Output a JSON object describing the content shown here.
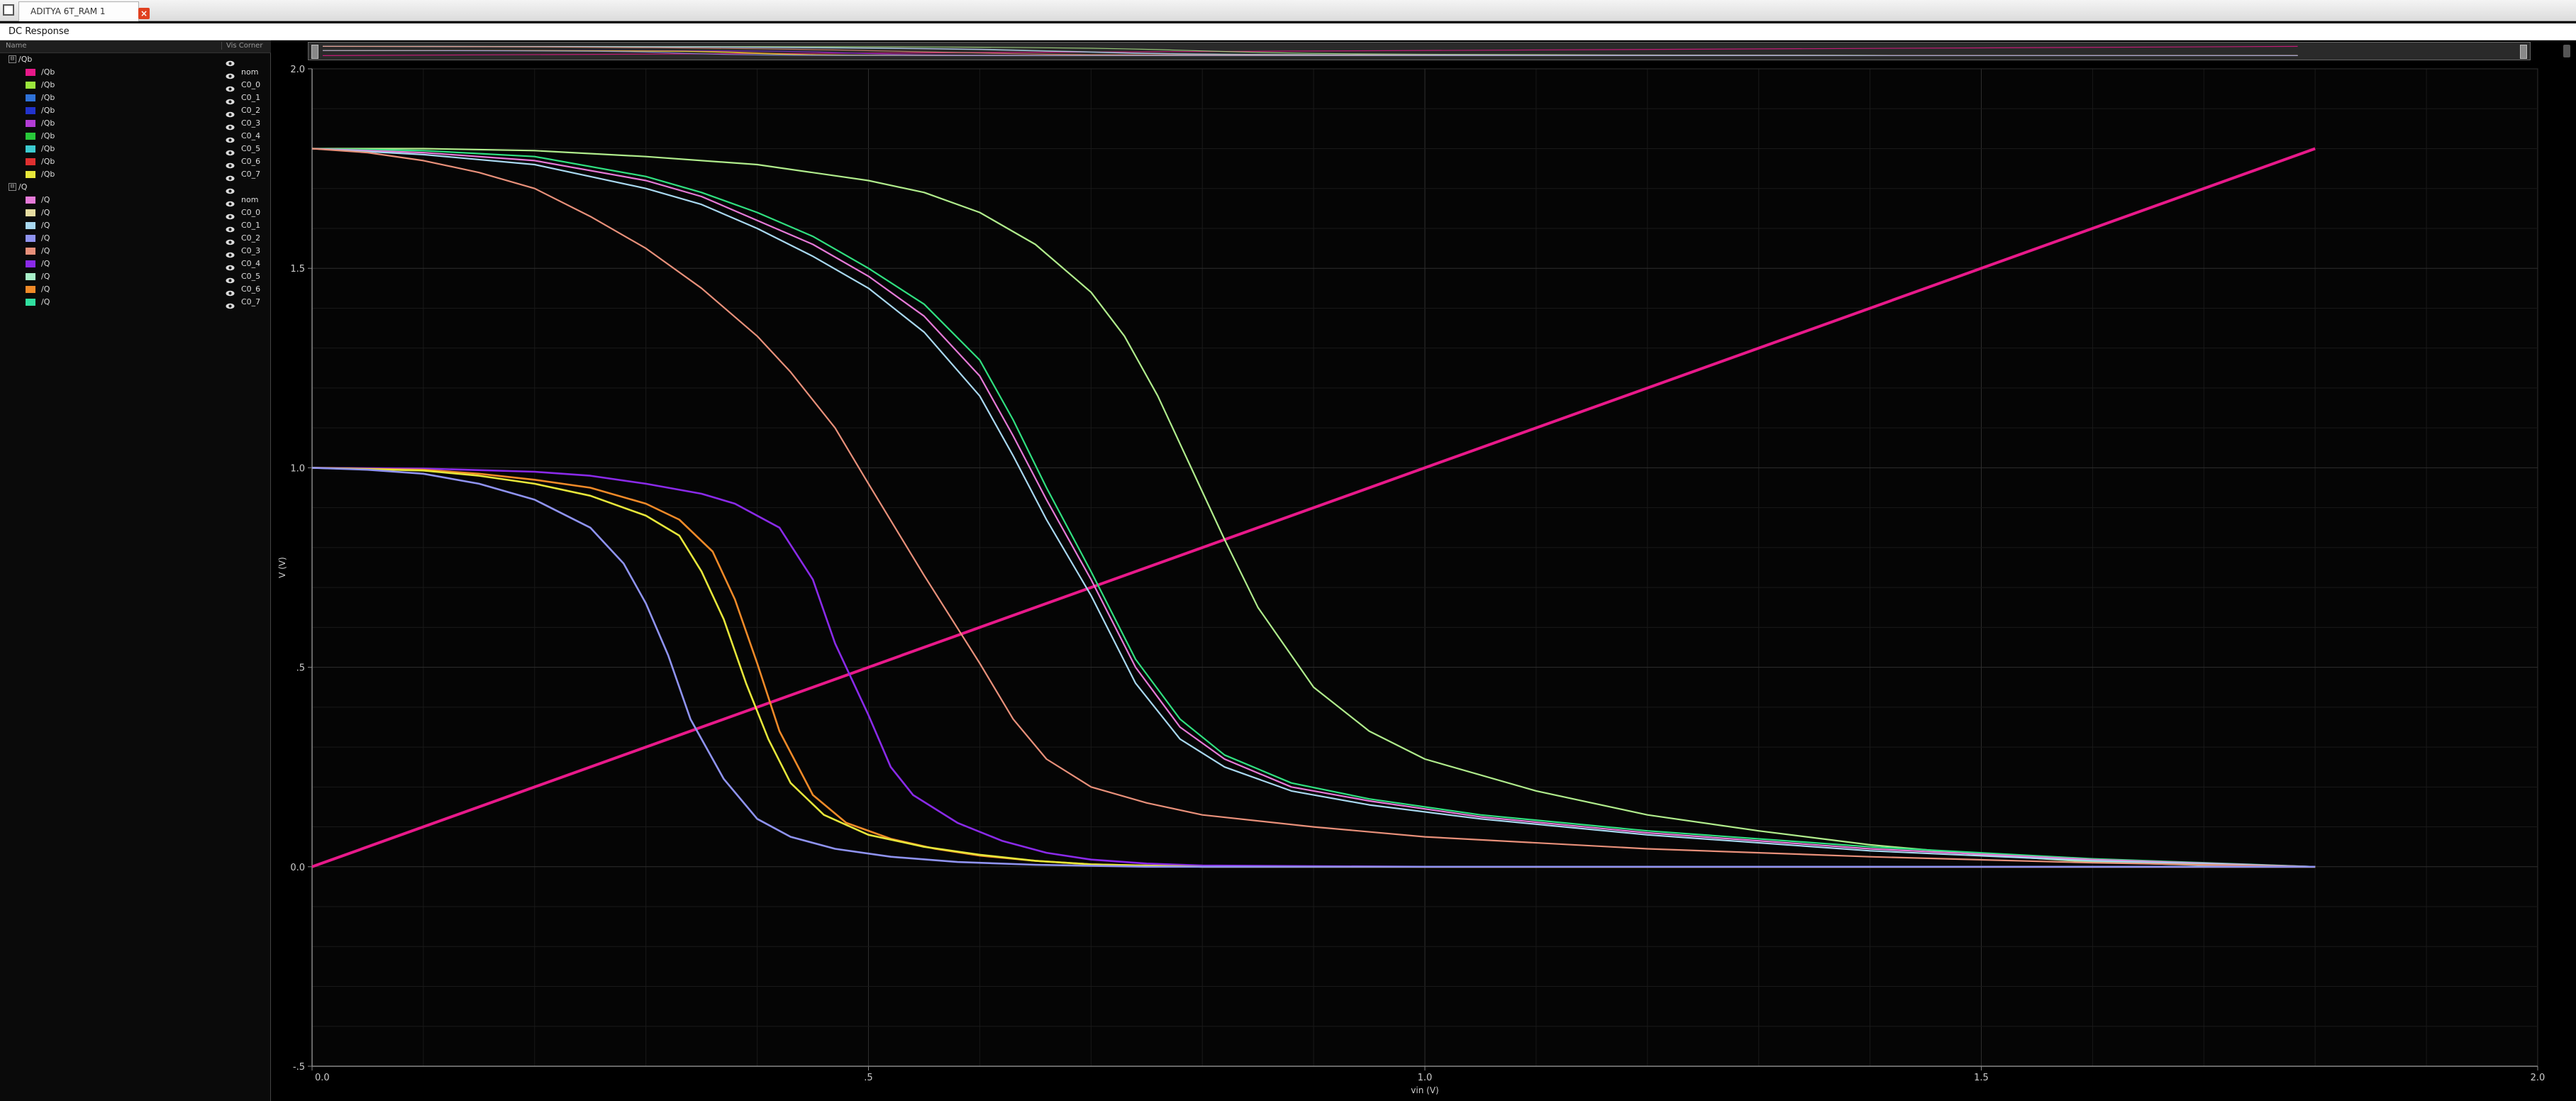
{
  "window": {
    "tab_title": "ADITYA 6T_RAM 1",
    "panel_title": "DC Response"
  },
  "browser": {
    "header_name": "Name",
    "header_corner": "Vis Corner",
    "groups": [
      {
        "name": "/Qb",
        "collapse_symbol": "⊟",
        "signals": [
          {
            "name": "/Qb",
            "corner": "nom",
            "color": "#e8198a"
          },
          {
            "name": "/Qb",
            "corner": "C0_0",
            "color": "#9be63c"
          },
          {
            "name": "/Qb",
            "corner": "C0_1",
            "color": "#2f72d8"
          },
          {
            "name": "/Qb",
            "corner": "C0_2",
            "color": "#2233cc"
          },
          {
            "name": "/Qb",
            "corner": "C0_3",
            "color": "#b33cd6"
          },
          {
            "name": "/Qb",
            "corner": "C0_4",
            "color": "#28c83a"
          },
          {
            "name": "/Qb",
            "corner": "C0_5",
            "color": "#3ccbd0"
          },
          {
            "name": "/Qb",
            "corner": "C0_6",
            "color": "#e03030"
          },
          {
            "name": "/Qb",
            "corner": "C0_7",
            "color": "#e6e63a"
          }
        ]
      },
      {
        "name": "/Q",
        "collapse_symbol": "⊟",
        "signals": [
          {
            "name": "/Q",
            "corner": "nom",
            "color": "#e67ad8"
          },
          {
            "name": "/Q",
            "corner": "C0_0",
            "color": "#e6dca0"
          },
          {
            "name": "/Q",
            "corner": "C0_1",
            "color": "#a8d8f0"
          },
          {
            "name": "/Q",
            "corner": "C0_2",
            "color": "#8f93f0"
          },
          {
            "name": "/Q",
            "corner": "C0_3",
            "color": "#e8907a"
          },
          {
            "name": "/Q",
            "corner": "C0_4",
            "color": "#8a2ae8"
          },
          {
            "name": "/Q",
            "corner": "C0_5",
            "color": "#a8f0c8"
          },
          {
            "name": "/Q",
            "corner": "C0_6",
            "color": "#f08a28"
          },
          {
            "name": "/Q",
            "corner": "C0_7",
            "color": "#30e0a0"
          }
        ]
      }
    ]
  },
  "chart_data": {
    "type": "line",
    "title": "",
    "xlabel": "vin (V)",
    "ylabel": "V (V)",
    "xlim": [
      0.0,
      2.0
    ],
    "ylim": [
      -0.5,
      2.0
    ],
    "x_ticks": [
      {
        "value": 0.0,
        "label": "0.0"
      },
      {
        "value": 0.5,
        "label": ".5"
      },
      {
        "value": 1.0,
        "label": "1.0"
      },
      {
        "value": 1.5,
        "label": "1.5"
      },
      {
        "value": 2.0,
        "label": "2.0"
      }
    ],
    "y_ticks": [
      {
        "value": -0.5,
        "label": "-.5"
      },
      {
        "value": 0.0,
        "label": "0.0"
      },
      {
        "value": 0.5,
        "label": ".5"
      },
      {
        "value": 1.0,
        "label": "1.0"
      },
      {
        "value": 1.5,
        "label": "1.5"
      },
      {
        "value": 2.0,
        "label": "2.0"
      }
    ],
    "grid": true,
    "series": [
      {
        "color": "#e8198a",
        "width": 4,
        "points": [
          [
            0.0,
            0.0
          ],
          [
            1.8,
            1.8
          ]
        ]
      },
      {
        "color": "#b0ec8c",
        "width": 2.2,
        "points": [
          [
            0.0,
            1.8
          ],
          [
            0.1,
            1.8
          ],
          [
            0.2,
            1.795
          ],
          [
            0.3,
            1.78
          ],
          [
            0.4,
            1.76
          ],
          [
            0.5,
            1.72
          ],
          [
            0.55,
            1.69
          ],
          [
            0.6,
            1.64
          ],
          [
            0.65,
            1.56
          ],
          [
            0.7,
            1.44
          ],
          [
            0.73,
            1.33
          ],
          [
            0.76,
            1.18
          ],
          [
            0.79,
            1.0
          ],
          [
            0.82,
            0.82
          ],
          [
            0.85,
            0.65
          ],
          [
            0.9,
            0.45
          ],
          [
            0.95,
            0.34
          ],
          [
            1.0,
            0.27
          ],
          [
            1.1,
            0.19
          ],
          [
            1.2,
            0.13
          ],
          [
            1.3,
            0.09
          ],
          [
            1.4,
            0.055
          ],
          [
            1.5,
            0.03
          ],
          [
            1.6,
            0.012
          ],
          [
            1.7,
            0.004
          ],
          [
            1.8,
            0.0
          ]
        ]
      },
      {
        "color": "#30e080",
        "width": 2.2,
        "points": [
          [
            0.0,
            1.8
          ],
          [
            0.1,
            1.795
          ],
          [
            0.2,
            1.78
          ],
          [
            0.3,
            1.73
          ],
          [
            0.35,
            1.69
          ],
          [
            0.4,
            1.64
          ],
          [
            0.45,
            1.58
          ],
          [
            0.5,
            1.5
          ],
          [
            0.55,
            1.41
          ],
          [
            0.6,
            1.27
          ],
          [
            0.63,
            1.12
          ],
          [
            0.66,
            0.95
          ],
          [
            0.7,
            0.74
          ],
          [
            0.74,
            0.52
          ],
          [
            0.78,
            0.37
          ],
          [
            0.82,
            0.28
          ],
          [
            0.88,
            0.21
          ],
          [
            0.95,
            0.17
          ],
          [
            1.05,
            0.13
          ],
          [
            1.2,
            0.09
          ],
          [
            1.4,
            0.05
          ],
          [
            1.6,
            0.02
          ],
          [
            1.8,
            0.0
          ]
        ]
      },
      {
        "color": "#e67ad8",
        "width": 2.2,
        "points": [
          [
            0.0,
            1.8
          ],
          [
            0.1,
            1.79
          ],
          [
            0.2,
            1.77
          ],
          [
            0.3,
            1.72
          ],
          [
            0.35,
            1.68
          ],
          [
            0.4,
            1.62
          ],
          [
            0.45,
            1.56
          ],
          [
            0.5,
            1.48
          ],
          [
            0.55,
            1.38
          ],
          [
            0.6,
            1.23
          ],
          [
            0.63,
            1.08
          ],
          [
            0.66,
            0.92
          ],
          [
            0.7,
            0.72
          ],
          [
            0.74,
            0.5
          ],
          [
            0.78,
            0.35
          ],
          [
            0.82,
            0.27
          ],
          [
            0.88,
            0.2
          ],
          [
            0.95,
            0.165
          ],
          [
            1.05,
            0.125
          ],
          [
            1.2,
            0.085
          ],
          [
            1.4,
            0.045
          ],
          [
            1.6,
            0.018
          ],
          [
            1.8,
            0.0
          ]
        ]
      },
      {
        "color": "#a8d8f0",
        "width": 2.2,
        "points": [
          [
            0.0,
            1.8
          ],
          [
            0.1,
            1.785
          ],
          [
            0.2,
            1.76
          ],
          [
            0.3,
            1.7
          ],
          [
            0.35,
            1.66
          ],
          [
            0.4,
            1.6
          ],
          [
            0.45,
            1.53
          ],
          [
            0.5,
            1.45
          ],
          [
            0.55,
            1.34
          ],
          [
            0.6,
            1.18
          ],
          [
            0.63,
            1.03
          ],
          [
            0.66,
            0.87
          ],
          [
            0.7,
            0.68
          ],
          [
            0.74,
            0.46
          ],
          [
            0.78,
            0.32
          ],
          [
            0.82,
            0.25
          ],
          [
            0.88,
            0.19
          ],
          [
            0.95,
            0.155
          ],
          [
            1.05,
            0.12
          ],
          [
            1.2,
            0.08
          ],
          [
            1.4,
            0.04
          ],
          [
            1.6,
            0.015
          ],
          [
            1.8,
            0.0
          ]
        ]
      },
      {
        "color": "#e8907a",
        "width": 2.2,
        "points": [
          [
            0.0,
            1.8
          ],
          [
            0.05,
            1.79
          ],
          [
            0.1,
            1.77
          ],
          [
            0.15,
            1.74
          ],
          [
            0.2,
            1.7
          ],
          [
            0.25,
            1.63
          ],
          [
            0.3,
            1.55
          ],
          [
            0.35,
            1.45
          ],
          [
            0.4,
            1.33
          ],
          [
            0.43,
            1.24
          ],
          [
            0.47,
            1.1
          ],
          [
            0.5,
            0.96
          ],
          [
            0.55,
            0.73
          ],
          [
            0.6,
            0.51
          ],
          [
            0.63,
            0.37
          ],
          [
            0.66,
            0.27
          ],
          [
            0.7,
            0.2
          ],
          [
            0.75,
            0.16
          ],
          [
            0.8,
            0.13
          ],
          [
            0.9,
            0.1
          ],
          [
            1.0,
            0.075
          ],
          [
            1.2,
            0.045
          ],
          [
            1.4,
            0.025
          ],
          [
            1.6,
            0.01
          ],
          [
            1.8,
            0.0
          ]
        ]
      },
      {
        "color": "#8a2ae8",
        "width": 2.6,
        "points": [
          [
            0.0,
            1.0
          ],
          [
            0.1,
            0.998
          ],
          [
            0.2,
            0.99
          ],
          [
            0.25,
            0.98
          ],
          [
            0.3,
            0.96
          ],
          [
            0.35,
            0.935
          ],
          [
            0.38,
            0.91
          ],
          [
            0.42,
            0.85
          ],
          [
            0.45,
            0.72
          ],
          [
            0.47,
            0.56
          ],
          [
            0.5,
            0.38
          ],
          [
            0.52,
            0.25
          ],
          [
            0.54,
            0.18
          ],
          [
            0.58,
            0.11
          ],
          [
            0.62,
            0.065
          ],
          [
            0.66,
            0.035
          ],
          [
            0.7,
            0.018
          ],
          [
            0.75,
            0.008
          ],
          [
            0.8,
            0.003
          ],
          [
            1.0,
            0.0
          ],
          [
            1.8,
            0.0
          ]
        ]
      },
      {
        "color": "#f08a28",
        "width": 2.6,
        "points": [
          [
            0.0,
            1.0
          ],
          [
            0.1,
            0.995
          ],
          [
            0.15,
            0.985
          ],
          [
            0.2,
            0.97
          ],
          [
            0.25,
            0.95
          ],
          [
            0.3,
            0.91
          ],
          [
            0.33,
            0.87
          ],
          [
            0.36,
            0.79
          ],
          [
            0.38,
            0.67
          ],
          [
            0.4,
            0.51
          ],
          [
            0.42,
            0.34
          ],
          [
            0.45,
            0.18
          ],
          [
            0.48,
            0.11
          ],
          [
            0.52,
            0.07
          ],
          [
            0.56,
            0.045
          ],
          [
            0.6,
            0.028
          ],
          [
            0.65,
            0.015
          ],
          [
            0.7,
            0.006
          ],
          [
            0.8,
            0.0
          ],
          [
            1.8,
            0.0
          ]
        ]
      },
      {
        "color": "#e6e63a",
        "width": 2.6,
        "points": [
          [
            0.0,
            1.0
          ],
          [
            0.1,
            0.993
          ],
          [
            0.15,
            0.98
          ],
          [
            0.2,
            0.96
          ],
          [
            0.25,
            0.93
          ],
          [
            0.3,
            0.88
          ],
          [
            0.33,
            0.83
          ],
          [
            0.35,
            0.74
          ],
          [
            0.37,
            0.62
          ],
          [
            0.39,
            0.46
          ],
          [
            0.41,
            0.32
          ],
          [
            0.43,
            0.21
          ],
          [
            0.46,
            0.13
          ],
          [
            0.5,
            0.08
          ],
          [
            0.55,
            0.05
          ],
          [
            0.6,
            0.03
          ],
          [
            0.65,
            0.015
          ],
          [
            0.7,
            0.006
          ],
          [
            0.8,
            0.0
          ],
          [
            1.8,
            0.0
          ]
        ]
      },
      {
        "color": "#8f93f0",
        "width": 2.6,
        "points": [
          [
            0.0,
            1.0
          ],
          [
            0.05,
            0.995
          ],
          [
            0.1,
            0.985
          ],
          [
            0.15,
            0.96
          ],
          [
            0.2,
            0.92
          ],
          [
            0.25,
            0.85
          ],
          [
            0.28,
            0.76
          ],
          [
            0.3,
            0.66
          ],
          [
            0.32,
            0.53
          ],
          [
            0.34,
            0.37
          ],
          [
            0.37,
            0.22
          ],
          [
            0.4,
            0.12
          ],
          [
            0.43,
            0.075
          ],
          [
            0.47,
            0.045
          ],
          [
            0.52,
            0.025
          ],
          [
            0.58,
            0.012
          ],
          [
            0.65,
            0.005
          ],
          [
            0.75,
            0.0
          ],
          [
            1.8,
            0.0
          ]
        ]
      }
    ]
  }
}
